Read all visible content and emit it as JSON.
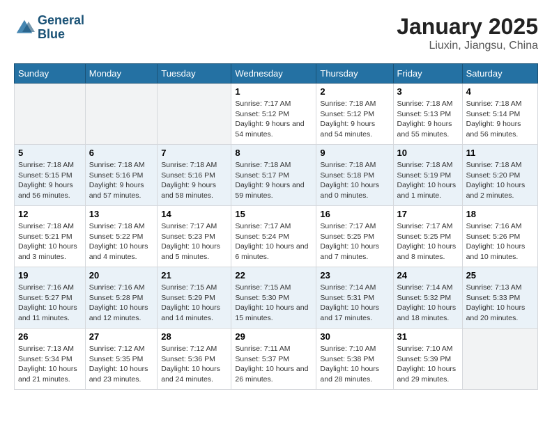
{
  "logo": {
    "line1": "General",
    "line2": "Blue"
  },
  "title": "January 2025",
  "subtitle": "Liuxin, Jiangsu, China",
  "days_of_week": [
    "Sunday",
    "Monday",
    "Tuesday",
    "Wednesday",
    "Thursday",
    "Friday",
    "Saturday"
  ],
  "weeks": [
    [
      {
        "day": "",
        "info": ""
      },
      {
        "day": "",
        "info": ""
      },
      {
        "day": "",
        "info": ""
      },
      {
        "day": "1",
        "info": "Sunrise: 7:17 AM\nSunset: 5:12 PM\nDaylight: 9 hours and 54 minutes."
      },
      {
        "day": "2",
        "info": "Sunrise: 7:18 AM\nSunset: 5:12 PM\nDaylight: 9 hours and 54 minutes."
      },
      {
        "day": "3",
        "info": "Sunrise: 7:18 AM\nSunset: 5:13 PM\nDaylight: 9 hours and 55 minutes."
      },
      {
        "day": "4",
        "info": "Sunrise: 7:18 AM\nSunset: 5:14 PM\nDaylight: 9 hours and 56 minutes."
      }
    ],
    [
      {
        "day": "5",
        "info": "Sunrise: 7:18 AM\nSunset: 5:15 PM\nDaylight: 9 hours and 56 minutes."
      },
      {
        "day": "6",
        "info": "Sunrise: 7:18 AM\nSunset: 5:16 PM\nDaylight: 9 hours and 57 minutes."
      },
      {
        "day": "7",
        "info": "Sunrise: 7:18 AM\nSunset: 5:16 PM\nDaylight: 9 hours and 58 minutes."
      },
      {
        "day": "8",
        "info": "Sunrise: 7:18 AM\nSunset: 5:17 PM\nDaylight: 9 hours and 59 minutes."
      },
      {
        "day": "9",
        "info": "Sunrise: 7:18 AM\nSunset: 5:18 PM\nDaylight: 10 hours and 0 minutes."
      },
      {
        "day": "10",
        "info": "Sunrise: 7:18 AM\nSunset: 5:19 PM\nDaylight: 10 hours and 1 minute."
      },
      {
        "day": "11",
        "info": "Sunrise: 7:18 AM\nSunset: 5:20 PM\nDaylight: 10 hours and 2 minutes."
      }
    ],
    [
      {
        "day": "12",
        "info": "Sunrise: 7:18 AM\nSunset: 5:21 PM\nDaylight: 10 hours and 3 minutes."
      },
      {
        "day": "13",
        "info": "Sunrise: 7:18 AM\nSunset: 5:22 PM\nDaylight: 10 hours and 4 minutes."
      },
      {
        "day": "14",
        "info": "Sunrise: 7:17 AM\nSunset: 5:23 PM\nDaylight: 10 hours and 5 minutes."
      },
      {
        "day": "15",
        "info": "Sunrise: 7:17 AM\nSunset: 5:24 PM\nDaylight: 10 hours and 6 minutes."
      },
      {
        "day": "16",
        "info": "Sunrise: 7:17 AM\nSunset: 5:25 PM\nDaylight: 10 hours and 7 minutes."
      },
      {
        "day": "17",
        "info": "Sunrise: 7:17 AM\nSunset: 5:25 PM\nDaylight: 10 hours and 8 minutes."
      },
      {
        "day": "18",
        "info": "Sunrise: 7:16 AM\nSunset: 5:26 PM\nDaylight: 10 hours and 10 minutes."
      }
    ],
    [
      {
        "day": "19",
        "info": "Sunrise: 7:16 AM\nSunset: 5:27 PM\nDaylight: 10 hours and 11 minutes."
      },
      {
        "day": "20",
        "info": "Sunrise: 7:16 AM\nSunset: 5:28 PM\nDaylight: 10 hours and 12 minutes."
      },
      {
        "day": "21",
        "info": "Sunrise: 7:15 AM\nSunset: 5:29 PM\nDaylight: 10 hours and 14 minutes."
      },
      {
        "day": "22",
        "info": "Sunrise: 7:15 AM\nSunset: 5:30 PM\nDaylight: 10 hours and 15 minutes."
      },
      {
        "day": "23",
        "info": "Sunrise: 7:14 AM\nSunset: 5:31 PM\nDaylight: 10 hours and 17 minutes."
      },
      {
        "day": "24",
        "info": "Sunrise: 7:14 AM\nSunset: 5:32 PM\nDaylight: 10 hours and 18 minutes."
      },
      {
        "day": "25",
        "info": "Sunrise: 7:13 AM\nSunset: 5:33 PM\nDaylight: 10 hours and 20 minutes."
      }
    ],
    [
      {
        "day": "26",
        "info": "Sunrise: 7:13 AM\nSunset: 5:34 PM\nDaylight: 10 hours and 21 minutes."
      },
      {
        "day": "27",
        "info": "Sunrise: 7:12 AM\nSunset: 5:35 PM\nDaylight: 10 hours and 23 minutes."
      },
      {
        "day": "28",
        "info": "Sunrise: 7:12 AM\nSunset: 5:36 PM\nDaylight: 10 hours and 24 minutes."
      },
      {
        "day": "29",
        "info": "Sunrise: 7:11 AM\nSunset: 5:37 PM\nDaylight: 10 hours and 26 minutes."
      },
      {
        "day": "30",
        "info": "Sunrise: 7:10 AM\nSunset: 5:38 PM\nDaylight: 10 hours and 28 minutes."
      },
      {
        "day": "31",
        "info": "Sunrise: 7:10 AM\nSunset: 5:39 PM\nDaylight: 10 hours and 29 minutes."
      },
      {
        "day": "",
        "info": ""
      }
    ]
  ]
}
